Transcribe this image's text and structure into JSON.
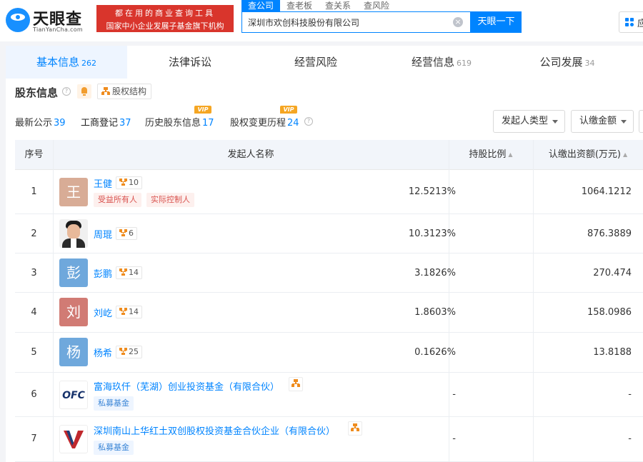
{
  "brand": {
    "logo_cn": "天眼查",
    "logo_en": "TianYanCha.com",
    "banner_line1": "都在用的商业查询工具",
    "banner_line2": "国家中小企业发展子基金旗下机构"
  },
  "search": {
    "tabs": [
      "查公司",
      "查老板",
      "查关系",
      "查风险"
    ],
    "value": "深圳市欢创科技股份有限公司",
    "button": "天眼一下"
  },
  "app_button": "应",
  "main_tabs": [
    {
      "label": "基本信息",
      "count": "262"
    },
    {
      "label": "法律诉讼",
      "count": ""
    },
    {
      "label": "经营风险",
      "count": ""
    },
    {
      "label": "经营信息",
      "count": "619"
    },
    {
      "label": "公司发展",
      "count": "34"
    }
  ],
  "section": {
    "title": "股东信息",
    "structure_button": "股权结构"
  },
  "sub_tabs": [
    {
      "label": "最新公示",
      "count": "39"
    },
    {
      "label": "工商登记",
      "count": "37"
    },
    {
      "label": "历史股东信息",
      "count": "17",
      "vip": "VIP"
    },
    {
      "label": "股权变更历程",
      "count": "24",
      "vip": "VIP"
    }
  ],
  "filters": {
    "founder_type": "发起人类型",
    "amount": "认缴金额"
  },
  "table": {
    "headers": {
      "idx": "序号",
      "name": "发起人名称",
      "ratio": "持股比例",
      "amount": "认缴出资额(万元)"
    },
    "rows": [
      {
        "idx": "1",
        "avatar": "王",
        "name": "王健",
        "rel": "10",
        "tags": [
          "受益所有人",
          "实际控制人"
        ],
        "ratio": "12.5213%",
        "amount": "1064.1212"
      },
      {
        "idx": "2",
        "avatar": "",
        "name": "周琨",
        "rel": "6",
        "tags": [],
        "ratio": "10.3123%",
        "amount": "876.3889"
      },
      {
        "idx": "3",
        "avatar": "彭",
        "name": "彭鹏",
        "rel": "14",
        "tags": [],
        "ratio": "3.1826%",
        "amount": "270.474"
      },
      {
        "idx": "4",
        "avatar": "刘",
        "name": "刘屹",
        "rel": "14",
        "tags": [],
        "ratio": "1.8603%",
        "amount": "158.0986"
      },
      {
        "idx": "5",
        "avatar": "杨",
        "name": "杨希",
        "rel": "25",
        "tags": [],
        "ratio": "0.1626%",
        "amount": "13.8188"
      },
      {
        "idx": "6",
        "avatar": "OFC",
        "name": "富海玖仟（芜湖）创业投资基金（有限合伙）",
        "rel": "",
        "tags": [
          "私募基金"
        ],
        "ratio": "-",
        "amount": "-"
      },
      {
        "idx": "7",
        "avatar": "",
        "name": "深圳南山上华红土双创股权投资基金合伙企业（有限合伙）",
        "rel": "",
        "tags": [
          "私募基金"
        ],
        "ratio": "-",
        "amount": "-"
      }
    ]
  },
  "colors": {
    "primary": "#0084ff",
    "banner_red": "#d9352c",
    "avatar_wang": "#d8ac96",
    "avatar_peng": "#6fa8dc",
    "avatar_liu": "#d17b74",
    "avatar_yang": "#6fa8dc"
  }
}
